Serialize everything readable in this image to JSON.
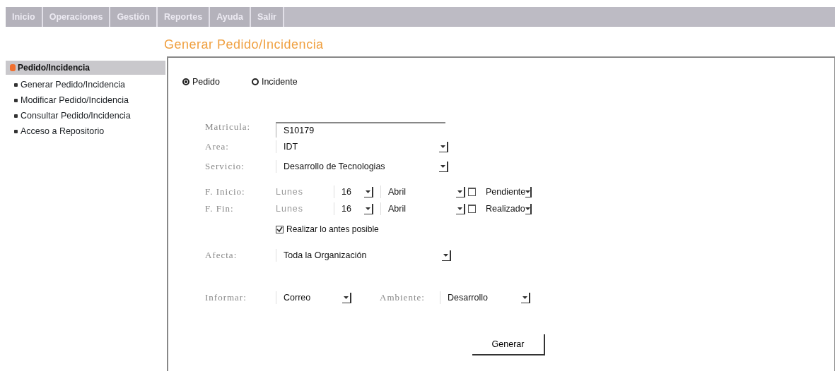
{
  "menu": [
    {
      "label": "Inicio"
    },
    {
      "label": "Operaciones"
    },
    {
      "label": "Gestión"
    },
    {
      "label": "Reportes"
    },
    {
      "label": "Ayuda"
    },
    {
      "label": "Salir"
    }
  ],
  "page_title": "Generar Pedido/Incidencia",
  "sidebar": {
    "header": "Pedido/Incidencia",
    "items": [
      "Generar Pedido/Incidencia",
      "Modificar Pedido/Incidencia",
      "Consultar Pedido/Incidencia",
      "Acceso a Repositorio"
    ]
  },
  "type_options": [
    {
      "label": "Pedido",
      "selected": true
    },
    {
      "label": "Incidente",
      "selected": false
    }
  ],
  "matricula": {
    "label": "Matricula:",
    "value": "S10179"
  },
  "area": {
    "label": "Area:",
    "value": "IDT"
  },
  "servicio": {
    "label": "Servicio:",
    "value": "Desarrollo de Tecnologias"
  },
  "dates": [
    {
      "label": "F. Inicio:",
      "weekday": "Lunes",
      "day": "16",
      "month": "Abril",
      "status": "Pendiente"
    },
    {
      "label": "F. Fin:",
      "weekday": "Lunes",
      "day": "16",
      "month": "Abril",
      "status": "Realizado"
    }
  ],
  "asap": {
    "label": "Realizar lo antes posible",
    "checked": true
  },
  "afecta": {
    "label": "Afecta:",
    "value": "Toda la Organización"
  },
  "informar": {
    "label": "Informar:",
    "value": "Correo"
  },
  "ambiente": {
    "label": "Ambiente:",
    "value": "Desarrollo"
  },
  "submit": "Generar"
}
